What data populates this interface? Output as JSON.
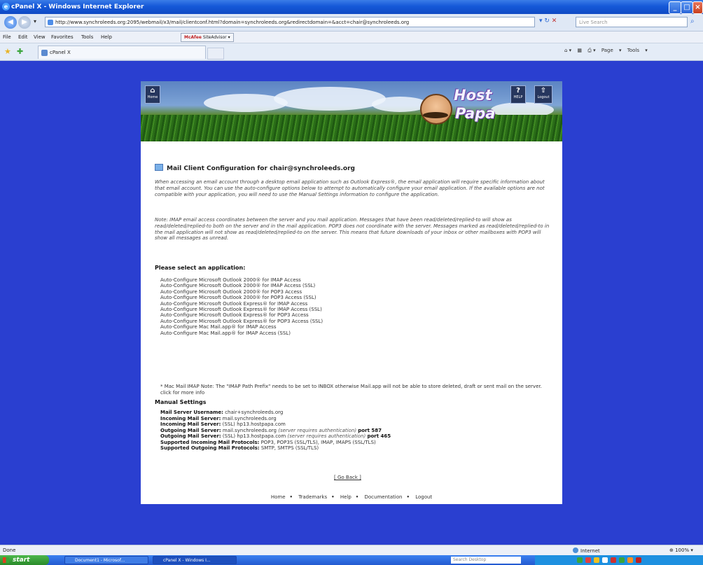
{
  "window": {
    "title": "cPanel X - Windows Internet Explorer",
    "min": "_",
    "max": "□",
    "close": "×"
  },
  "address_bar": {
    "url": "http://www.synchroleeds.org:2095/webmail/x3/mail/clientconf.html?domain=synchroleeds.org&redirectdomain=&acct=chair@synchroleeds.org",
    "search_placeholder": "Live Search"
  },
  "menu": {
    "items": [
      "File",
      "Edit",
      "View",
      "Favorites",
      "Tools",
      "Help"
    ],
    "mcafee": "SiteAdvisor"
  },
  "tab": {
    "label": "cPanel X"
  },
  "command_bar": {
    "page": "Page",
    "tools": "Tools"
  },
  "header": {
    "home_label": "Home",
    "help_label": "HELP",
    "logout_label": "Logout",
    "logo_top": "Host",
    "logo_bottom": "Papa"
  },
  "page": {
    "heading": "Mail Client Configuration for chair@synchroleeds.org",
    "intro": "When accessing an email account through a desktop email application such as Outlook Express®, the email application will require specific information about that email account. You can use the auto-configure options below to attempt to automatically configure your email application. If the available options are not compatible with your application, you will need to use the Manual Settings information to configure the application.",
    "note": "Note: IMAP email access coordinates between the server and you mail application. Messages that have been read/deleted/replied-to will show as read/deleted/replied-to both on the server and in the mail application. POP3 does not coordinate with the server. Messages marked as read/deleted/replied-to in the mail application will not show as read/deleted/replied-to on the server. This means that future downloads of your inbox or other mailboxes with POP3 will show all messages as unread.",
    "select_heading": "Please select an application:",
    "apps": [
      "Auto-Configure Microsoft Outlook 2000® for IMAP Access",
      "Auto-Configure Microsoft Outlook 2000® for IMAP Access (SSL)",
      "Auto-Configure Microsoft Outlook 2000® for POP3 Access",
      "Auto-Configure Microsoft Outlook 2000® for POP3 Access (SSL)",
      "Auto-Configure Microsoft Outlook Express® for IMAP Access",
      "Auto-Configure Microsoft Outlook Express® for IMAP Access (SSL)",
      "Auto-Configure Microsoft Outlook Express® for POP3 Access",
      "Auto-Configure Microsoft Outlook Express® for POP3 Access (SSL)",
      "Auto-Configure Mac Mail.app® for IMAP Access",
      "Auto-Configure Mac Mail.app® for IMAP Access (SSL)"
    ],
    "mac_note": "* Mac Mail IMAP Note: The \"IMAP Path Prefix\" needs to be set to INBOX otherwise Mail.app will not be able to store deleted, draft or sent mail on the server. click for more info",
    "manual_heading": "Manual Settings",
    "manual": {
      "username_label": "Mail Server Username:",
      "username": "chair+synchroleeds.org",
      "incoming_label": "Incoming Mail Server:",
      "incoming": "mail.synchroleeds.org",
      "incoming_ssl_label": "Incoming Mail Server:",
      "incoming_ssl": "(SSL) hp13.hostpapa.com",
      "outgoing_label": "Outgoing Mail Server:",
      "outgoing": "mail.synchroleeds.org",
      "outgoing_auth": "(server requires authentication)",
      "outgoing_port": "port 587",
      "outgoing_ssl_label": "Outgoing Mail Server:",
      "outgoing_ssl": "(SSL) hp13.hostpapa.com",
      "outgoing_ssl_auth": "(server requires authentication)",
      "outgoing_ssl_port": "port 465",
      "in_protocols_label": "Supported Incoming Mail Protocols:",
      "in_protocols": "POP3, POP3S (SSL/TLS), IMAP, IMAPS (SSL/TLS)",
      "out_protocols_label": "Supported Outgoing Mail Protocols:",
      "out_protocols": "SMTP, SMTPS (SSL/TLS)"
    },
    "go_back": "[ Go Back ]",
    "footer": [
      "Home",
      "Trademarks",
      "Help",
      "Documentation",
      "Logout"
    ]
  },
  "status": {
    "left": "Done",
    "zone": "Internet",
    "zoom": "100%"
  },
  "taskbar": {
    "start": "start",
    "items": [
      "Document1 - Microsof...",
      "cPanel X - Windows I..."
    ],
    "search_placeholder": "Search Desktop"
  }
}
